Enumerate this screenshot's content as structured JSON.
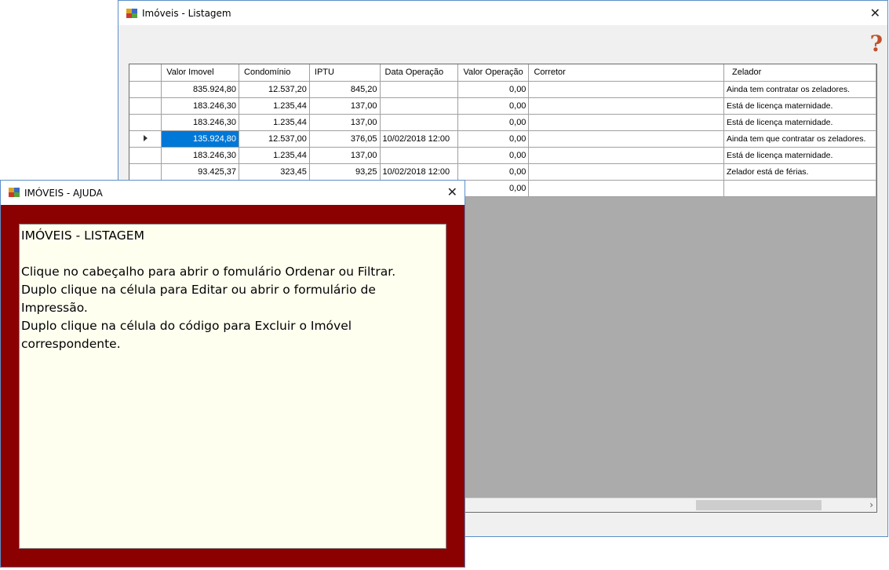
{
  "main_window": {
    "title": "Imóveis - Listagem",
    "close_glyph": "✕",
    "help_glyph": "?",
    "help_icon_color": "#c0502c",
    "grid": {
      "columns": [
        "Valor Imovel",
        "Condomínio",
        "IPTU",
        "Data Operação",
        "Valor Operação",
        "Corretor",
        "Zelador"
      ],
      "rows": [
        {
          "valor_imovel": "835.924,80",
          "condominio": "12.537,20",
          "iptu": "845,20",
          "data_operacao": "",
          "valor_operacao": "0,00",
          "corretor": "",
          "zelador": "Ainda tem contratar os zeladores."
        },
        {
          "valor_imovel": "183.246,30",
          "condominio": "1.235,44",
          "iptu": "137,00",
          "data_operacao": "",
          "valor_operacao": "0,00",
          "corretor": "",
          "zelador": "Está de licença maternidade."
        },
        {
          "valor_imovel": "183.246,30",
          "condominio": "1.235,44",
          "iptu": "137,00",
          "data_operacao": "",
          "valor_operacao": "0,00",
          "corretor": "",
          "zelador": "Está de licença maternidade."
        },
        {
          "valor_imovel": "135.924,80",
          "condominio": "12.537,00",
          "iptu": "376,05",
          "data_operacao": "10/02/2018 12:00",
          "valor_operacao": "0,00",
          "corretor": "",
          "zelador": "Ainda tem que contratar os zeladores.",
          "current": true
        },
        {
          "valor_imovel": "183.246,30",
          "condominio": "1.235,44",
          "iptu": "137,00",
          "data_operacao": "",
          "valor_operacao": "0,00",
          "corretor": "",
          "zelador": "Está de licença maternidade."
        },
        {
          "valor_imovel": "93.425,37",
          "condominio": "323,45",
          "iptu": "93,25",
          "data_operacao": "10/02/2018 12:00",
          "valor_operacao": "0,00",
          "corretor": "",
          "zelador": "Zelador está de férias."
        },
        {
          "valor_imovel": "",
          "condominio": "",
          "iptu": "",
          "data_operacao": "",
          "valor_operacao": "0,00",
          "corretor": "",
          "zelador": ""
        }
      ],
      "selected_color": "#0078d7"
    }
  },
  "help_window": {
    "title": "IMÓVEIS - AJUDA",
    "close_glyph": "✕",
    "background_color": "#8b0000",
    "text": "IMÓVEIS - LISTAGEM\n\nClique no cabeçalho para abrir o fomulário Ordenar ou Filtrar.\nDuplo clique na célula para Editar ou abrir o formulário de Impressão.\nDuplo clique na célula do código para Excluir o Imóvel\ncorrespondente."
  }
}
